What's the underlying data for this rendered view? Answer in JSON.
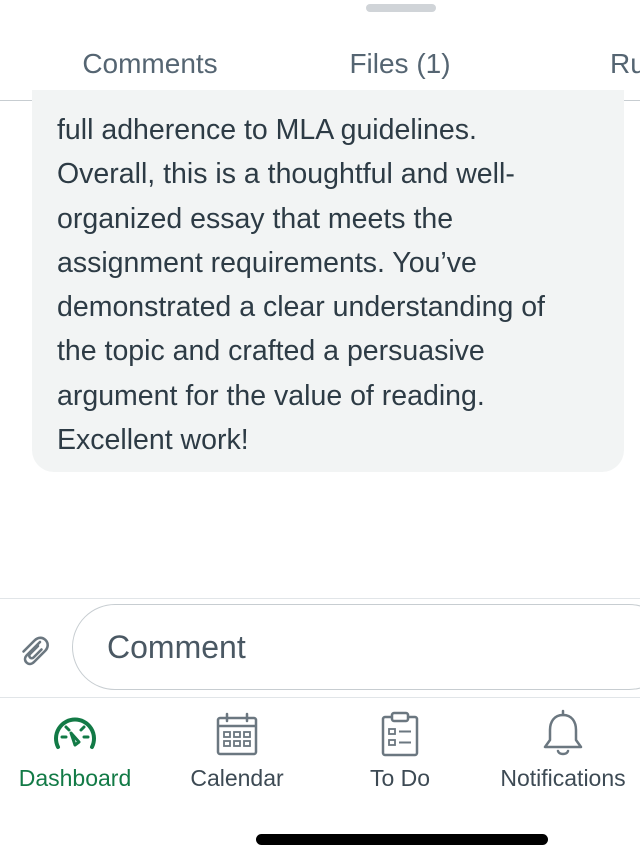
{
  "tabs": [
    {
      "label": "Comments",
      "selected": true
    },
    {
      "label": "Files (1)",
      "selected": false
    },
    {
      "label": "Ru",
      "selected": false
    }
  ],
  "comment": {
    "lines": [
      "full adherence to MLA guidelines.",
      "Overall, this is a thoughtful and well-",
      "organized essay that meets the",
      "assignment requirements. You’ve",
      "demonstrated a clear understanding of",
      "the topic and crafted a persuasive",
      "argument for the value of reading.",
      "Excellent work!"
    ]
  },
  "composer": {
    "placeholder": "Comment",
    "attach_icon": "paperclip-icon"
  },
  "bottom_nav": [
    {
      "label": "Dashboard",
      "icon": "dashboard-gauge-icon",
      "active": true
    },
    {
      "label": "Calendar",
      "icon": "calendar-icon",
      "active": false
    },
    {
      "label": "To Do",
      "icon": "clipboard-todo-icon",
      "active": false
    },
    {
      "label": "Notifications",
      "icon": "bell-icon",
      "active": false
    }
  ],
  "colors": {
    "accent_blue": "#0770a3",
    "active_green": "#127a46",
    "text": "#2d3b45",
    "bubble_bg": "#f2f4f4",
    "icon_gray": "#6b7780"
  }
}
